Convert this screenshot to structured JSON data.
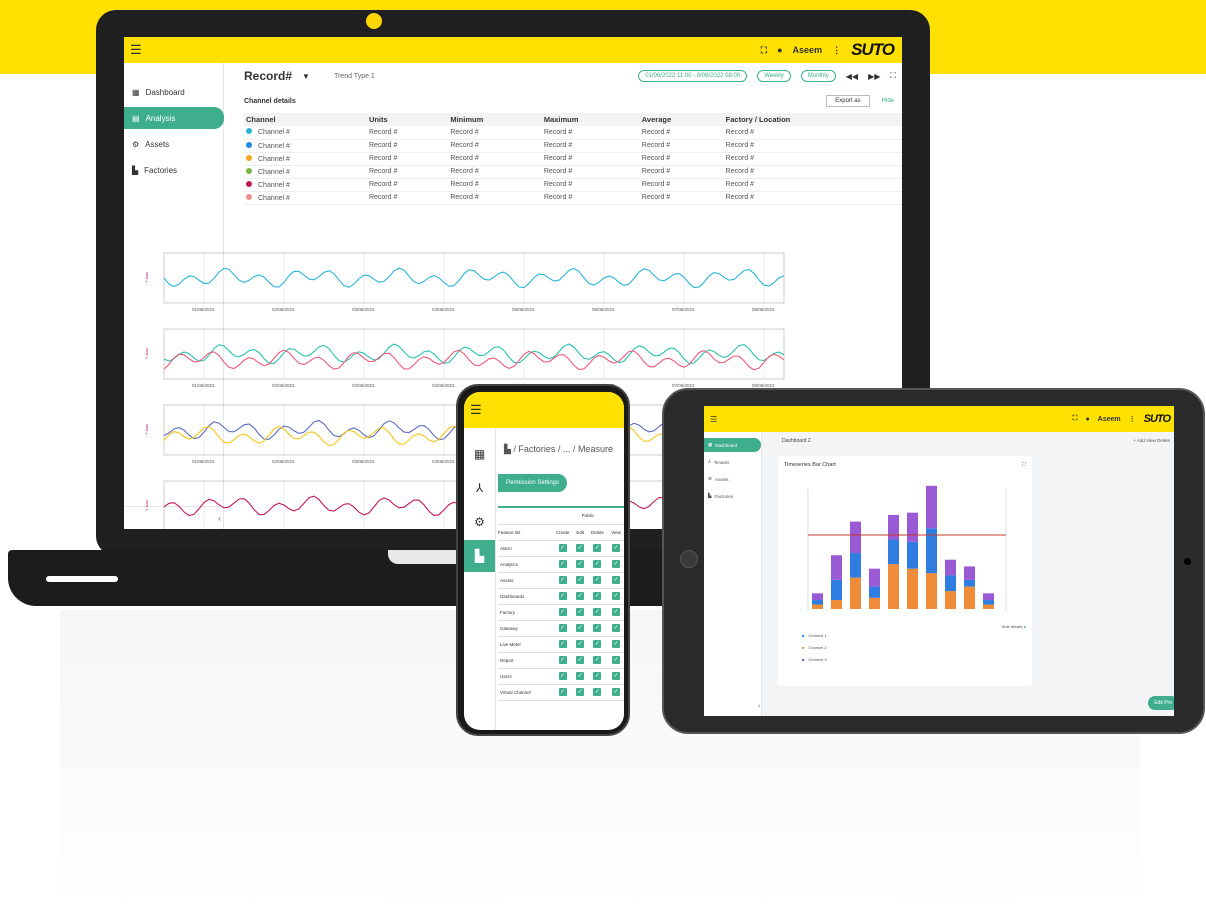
{
  "laptop": {
    "brand_logo": "SUTO",
    "user_name": "Aseem",
    "sidebar": [
      "Dashboard",
      "Analysis",
      "Assets",
      "Factories"
    ],
    "active_item": "Analysis",
    "record_label": "Record#",
    "trend_type": "Trend Type 1",
    "date_range": "01/06/2022 11:00 - 8/06/2022 08:00",
    "weekly": "Weekly",
    "monthly": "Monthly",
    "channel_details": "Channel details",
    "export_as": "Export as",
    "hide": "Hide",
    "table": {
      "headers": [
        "Channel",
        "Units",
        "Minimum",
        "Maximum",
        "Average",
        "Factory / Location"
      ],
      "rows": [
        {
          "color": "#29b6d8",
          "name": "Channel #",
          "cells": [
            "Record #",
            "Record #",
            "Record #",
            "Record #",
            "Record #"
          ]
        },
        {
          "color": "#1e88e5",
          "name": "Channel #",
          "cells": [
            "Record #",
            "Record #",
            "Record #",
            "Record #",
            "Record #"
          ]
        },
        {
          "color": "#f5a623",
          "name": "Channel #",
          "cells": [
            "Record #",
            "Record #",
            "Record #",
            "Record #",
            "Record #"
          ]
        },
        {
          "color": "#7cb342",
          "name": "Channel #",
          "cells": [
            "Record #",
            "Record #",
            "Record #",
            "Record #",
            "Record #"
          ]
        },
        {
          "color": "#c2185b",
          "name": "Channel #",
          "cells": [
            "Record #",
            "Record #",
            "Record #",
            "Record #",
            "Record #"
          ]
        },
        {
          "color": "#ef8f8f",
          "name": "Channel #",
          "cells": [
            "Record #",
            "Record #",
            "Record #",
            "Record #",
            "Record #"
          ]
        }
      ]
    },
    "chart_dates": [
      "01/06/2022",
      "02/06/2022",
      "03/06/2022",
      "04/06/2022",
      "05/06/2022",
      "06/06/2022",
      "07/06/2022",
      "08/06/2022"
    ],
    "y_axis_label": "Y Axis"
  },
  "phone": {
    "breadcrumb": "/ Factories / ... / Measure",
    "permission_button": "Permission Settings",
    "public_header": "Public",
    "feature_header": "Feature list",
    "cols": [
      "Create",
      "Edit",
      "Delete",
      "View"
    ],
    "features": [
      "Alarm",
      "Analytics",
      "Assets",
      "Dashboards",
      "Factory",
      "Gateway",
      "Live Meter",
      "Report",
      "Users",
      "Virtual Channel"
    ]
  },
  "tablet": {
    "user_name": "Aseem",
    "brand_logo": "SUTO",
    "sidebar": [
      "Dashboard",
      "Tenants",
      "Assets",
      "Factories"
    ],
    "dashboard_select": "Dashboard 2",
    "actions": "+ Add   View   Delete",
    "card_title": "Timeseries Bar Chart",
    "hide_details": "Hide details",
    "edit": "Edit Pro",
    "legend": [
      "Channel 1",
      "Channel 2",
      "Channel 3"
    ]
  },
  "colors": {
    "brand_yellow": "#ffe100",
    "accent_green": "#3fae8c"
  }
}
